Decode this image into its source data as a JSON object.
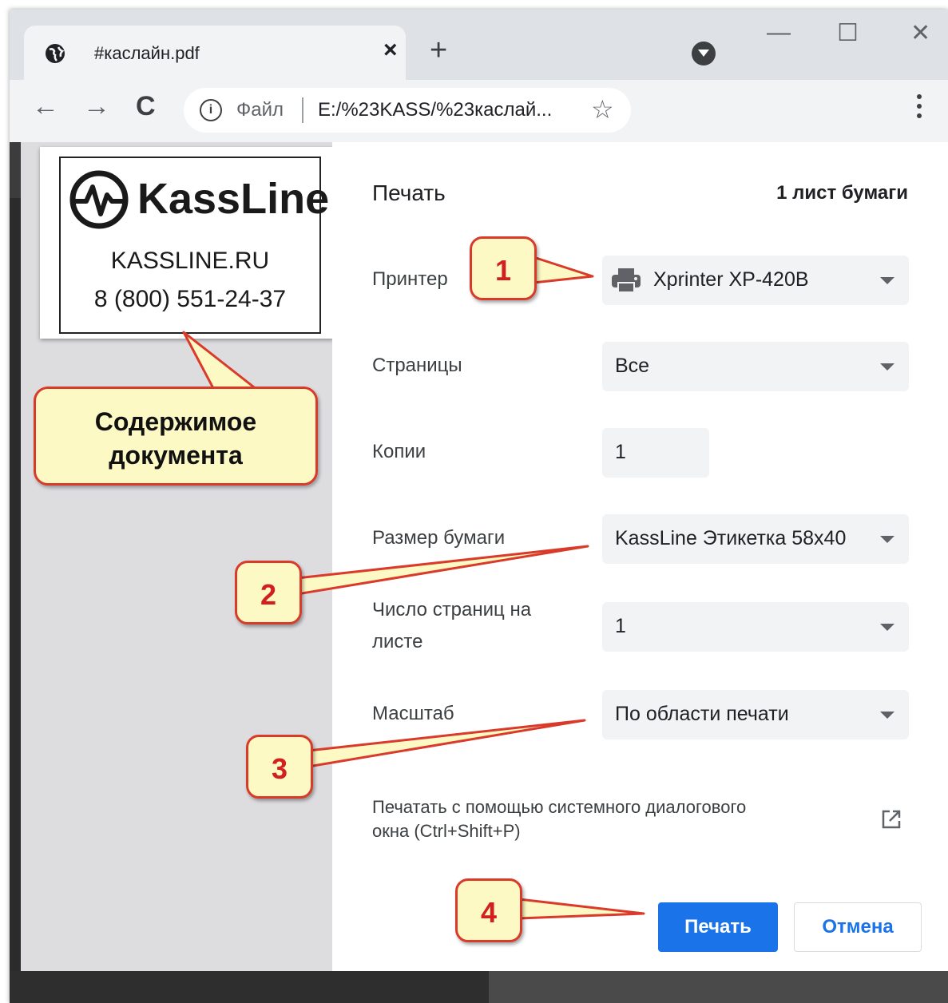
{
  "tab": {
    "title": "#каслайн.pdf",
    "close": "×"
  },
  "toolbar": {
    "new_tab": "+",
    "back": "←",
    "forward": "→",
    "reload": "C",
    "scheme": "Файл",
    "url": "E:/%23KASS/%23каслай...",
    "bookmark": "☆",
    "info": "i"
  },
  "window_controls": {
    "minimize": "—",
    "maximize": "☐",
    "close": "✕"
  },
  "preview": {
    "logo": "KassLine",
    "site": "KASSLINE.RU",
    "phone": "8 (800) 551-24-37"
  },
  "callout": {
    "line1": "Содержимое",
    "line2": "документа"
  },
  "dialog": {
    "title": "Печать",
    "sheets": "1 лист бумаги",
    "printer_label": "Принтер",
    "printer_value": "Xprinter XP-420B",
    "pages_label": "Страницы",
    "pages_value": "Все",
    "copies_label": "Копии",
    "copies_value": "1",
    "paper_label": "Размер бумаги",
    "paper_value": "KassLine Этикетка 58x40",
    "per_sheet_label_1": "Число страниц на",
    "per_sheet_label_2": "листе",
    "per_sheet_value": "1",
    "scale_label": "Масштаб",
    "scale_value": "По области печати",
    "system_dialog_1": "Печатать с помощью системного диалогового",
    "system_dialog_2": "окна (Ctrl+Shift+P)",
    "print_button": "Печать",
    "cancel_button": "Отмена"
  },
  "badges": [
    "1",
    "2",
    "3",
    "4"
  ],
  "colors": {
    "accent": "#1a73e8",
    "badge_border": "#d93a2a",
    "badge_fill": "#fdf9c4",
    "badge_text": "#d21f1f"
  }
}
